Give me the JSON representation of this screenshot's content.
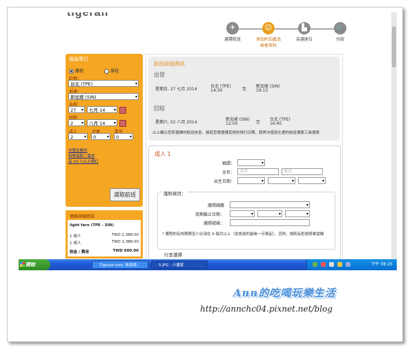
{
  "logo": "tigerair",
  "steps": [
    {
      "label": "選擇航班",
      "icon": "plane-icon"
    },
    {
      "label": "添加附加產品\n乘客資料",
      "icon": "people-icon",
      "active": true
    },
    {
      "label": "自選座位",
      "icon": "seat-icon"
    },
    {
      "label": "付款",
      "icon": "cart-icon"
    }
  ],
  "search": {
    "title": "搜尋票訂",
    "trip_types": [
      "雙程",
      "單程"
    ],
    "origin_label": "起飛：",
    "origin": "台北 (TPE)",
    "dest_label": "抵達：",
    "dest": "新加坡 (SIN)",
    "depart_label": "去程",
    "depart_day": "27",
    "depart_month": "七月 14",
    "return_label": "回程",
    "return_day": "2",
    "return_month": "八月 14",
    "adult_label": "成人",
    "child_label": "兒童",
    "infant_label": "嬰兒",
    "adults": "2",
    "children": "0",
    "infants": "0",
    "links": [
      "兒童及嬰兒",
      "特殊協助 / 需求",
      "高 10 人以上預訂"
    ],
    "button": "選取航班"
  },
  "price": {
    "title": "價格詳細資訊",
    "fare": "light fare (TPE - SIN)",
    "rows": [
      {
        "label": "1 成人",
        "value": "TWD  2,388.00"
      },
      {
        "label": "1 成人",
        "value": "TWD  2,388.00"
      }
    ],
    "tax_label": "稅金 / 費用",
    "tax_value": "TWD   600.00"
  },
  "flight": {
    "title": "航班詳細資訊",
    "outbound_label": "出發",
    "outbound_date": "星期日, 27 七月 2014",
    "outbound_from": "台北 (TPE)",
    "outbound_dep": "14:30",
    "outbound_to": "新加坡 (SIN)",
    "outbound_arr": "19:15",
    "return_label": "回程",
    "return_date": "星期六, 02 八月 2014",
    "return_from": "新加坡 (SIN)",
    "return_dep": "12:00",
    "return_to": "台北 (TPE)",
    "return_arr": "16:45",
    "arrow": "至",
    "note": "以上顯示您所選擇的航班信息，倘若您想選擇其他的飛行日期，請再次使用左邊的航班搜索工具搜索"
  },
  "passenger": {
    "title": "成人 1",
    "title_label": "稱謂：",
    "name_label": "全名：",
    "first_placeholder": "名字",
    "last_placeholder": "姓氏",
    "dob_label": "出生日期：",
    "passport_title": "護照資訊：",
    "country_label": "護照國籍",
    "expiry_label": "效期截止日期：",
    "number_label": "護照號碼：",
    "passport_note": "* 護照的有效期限至少必須在 6 個月以上（從旅遊的最後一日算起），否則，總統有拒絕搭乘當機",
    "luggage_title": "行李選擇"
  },
  "taskbar": {
    "start": "開始",
    "tasks": [
      "Tigerair.com: 新加坡...",
      "5.JPG - 小畫家"
    ],
    "clock": "下午 08:25"
  },
  "watermark": {
    "brand": "Ann的吃喝玩樂生活",
    "url": "http://annchc04.pixnet.net/blog"
  }
}
